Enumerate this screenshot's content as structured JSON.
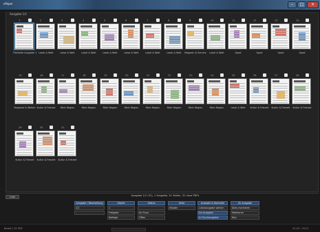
{
  "window": {
    "title": "ePaper"
  },
  "panel": {
    "title": "Ausgabe 1/1"
  },
  "pages": [
    {
      "num": "1",
      "label": "Titelseite Ausgabe 1"
    },
    {
      "num": "2",
      "label": "Lokal & Welt"
    },
    {
      "num": "3",
      "label": "Lokal & Welt"
    },
    {
      "num": "4",
      "label": "Lokal & Welt"
    },
    {
      "num": "5",
      "label": "Lokal & Welt"
    },
    {
      "num": "6",
      "label": "Lokal & Welt"
    },
    {
      "num": "7",
      "label": "Lokal & Welt"
    },
    {
      "num": "8",
      "label": "Lokal & Welt"
    },
    {
      "num": "9",
      "label": "Magazin & Service"
    },
    {
      "num": "10",
      "label": "Lokal & Welt"
    },
    {
      "num": "11",
      "label": "Sport"
    },
    {
      "num": "12",
      "label": "Sport"
    },
    {
      "num": "13",
      "label": "Sport"
    },
    {
      "num": "14",
      "label": "Sport"
    },
    {
      "num": "15",
      "label": "Regional & Welten"
    },
    {
      "num": "16",
      "label": "Kultur & Freizeit"
    },
    {
      "num": "17",
      "label": "Mein Region"
    },
    {
      "num": "18",
      "label": "Mein Region"
    },
    {
      "num": "19",
      "label": "Mein Region"
    },
    {
      "num": "20",
      "label": "Mein Region"
    },
    {
      "num": "21",
      "label": "Mein Region"
    },
    {
      "num": "22",
      "label": "Mein Region"
    },
    {
      "num": "23",
      "label": "Mein Region"
    },
    {
      "num": "24",
      "label": "Mein Region"
    },
    {
      "num": "25",
      "label": "Lokal & Welt"
    },
    {
      "num": "26",
      "label": "Kultur & Freizeit"
    },
    {
      "num": "27",
      "label": "Kultur & Freizeit"
    },
    {
      "num": "28",
      "label": "Kultur & Freizeit"
    },
    {
      "num": "29",
      "label": "Kultur & Freizeit"
    },
    {
      "num": "30",
      "label": "Kultur & Freizeit"
    },
    {
      "num": "31",
      "label": "Kultur & Freizeit"
    }
  ],
  "bottom": {
    "button_label": "Liste",
    "summary": "Ausgabe 1/1 (31), 1 Ausgabe, 31 Seiten, 31 neue PDFs",
    "columns": [
      {
        "header": "Ausgabe / Bearbeitung",
        "values": [
          "1/1",
          ""
        ]
      },
      {
        "header": "Objekt",
        "values": [
          "1",
          "Freigabe",
          "Abfrage"
        ]
      },
      {
        "header": "Status",
        "values": [
          "",
          "Im Fluss",
          "Offen"
        ]
      },
      {
        "header": "Seite",
        "values": [
          "Header"
        ]
      },
      {
        "header": "Auswahl & Kontrolle",
        "values": [
          "Lokalausgabe wählen",
          "Ins Ausgabe",
          "In Druckausgabe"
        ]
      },
      {
        "header": "Zu Ausgabe",
        "values": [
          "Alles markieren",
          "Markieren",
          "Neu"
        ]
      }
    ]
  },
  "status": {
    "left": "Bereit | 31 PDF",
    "right": "00:00 / 2024"
  }
}
